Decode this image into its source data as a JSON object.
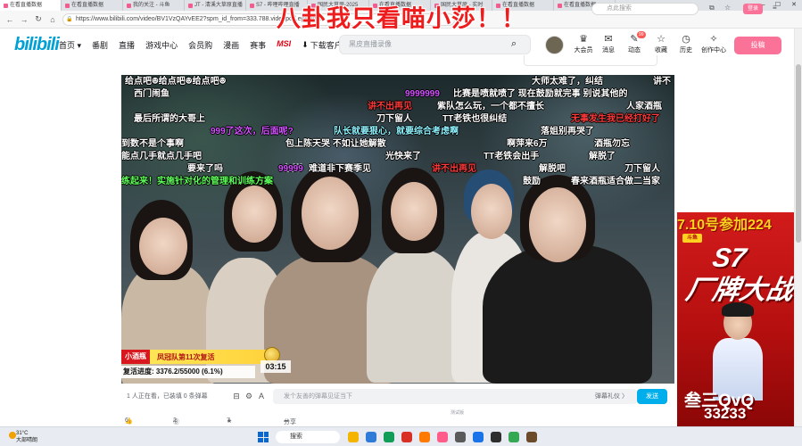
{
  "browser": {
    "tabs": [
      {
        "title": "在看直播数据"
      },
      {
        "title": "在看直播数据"
      },
      {
        "title": "我的关注 - 斗鱼"
      },
      {
        "title": "JT - 清溪大草原直播"
      },
      {
        "title": "S7 - 哔哩哔哩直播"
      },
      {
        "title": "国民大草原-2025"
      },
      {
        "title": "在看直播数据"
      },
      {
        "title": "国民大草原 - 实时"
      },
      {
        "title": "在看直播数据"
      },
      {
        "title": "在看直播数据"
      }
    ],
    "url": "https://www.bilibili.com/video/BV1VzQAYvEE2?spm_id_from=333.788.videopod.episodes",
    "search_placeholder": "点此搜索",
    "login_label": "登录"
  },
  "overlay_title": "八卦我只看喵小莎！！",
  "header": {
    "logo": "bilibili",
    "nav": [
      {
        "label": "首页 ▾"
      },
      {
        "label": "番剧"
      },
      {
        "label": "直播"
      },
      {
        "label": "游戏中心"
      },
      {
        "label": "会员购"
      },
      {
        "label": "漫画"
      },
      {
        "label": "赛事"
      },
      {
        "label": "MSI"
      },
      {
        "label": "下载客户端"
      }
    ],
    "search_placeholder": "黑皮直播录像",
    "right_items": [
      {
        "label": "大会员",
        "icon": "vip-icon"
      },
      {
        "label": "消息",
        "icon": "message-icon"
      },
      {
        "label": "动态",
        "icon": "dynamic-icon",
        "badge": "99"
      },
      {
        "label": "收藏",
        "icon": "star-icon"
      },
      {
        "label": "历史",
        "icon": "history-icon"
      },
      {
        "label": "创作中心",
        "icon": "creator-icon"
      }
    ],
    "upload_label": "投稿"
  },
  "video": {
    "streamer_logo": "bili",
    "danmaku": [
      {
        "text": "给点吧ꔮ给点吧ꔮ给点吧ꔮ",
        "color": "white"
      },
      {
        "text": "西门闹鱼",
        "color": "white"
      },
      {
        "text": "9999999",
        "color": "purple"
      },
      {
        "text": "比赛是喷就喷了 现在鼓励就完事 别说其他的",
        "color": "white"
      },
      {
        "text": "大师太难了，纠结",
        "color": "white"
      },
      {
        "text": "讲不",
        "color": "white"
      },
      {
        "text": "最后所谓的大哥上",
        "color": "white"
      },
      {
        "text": "讲不出再见",
        "color": "red"
      },
      {
        "text": "紫队怎么玩，一个都不擅长",
        "color": "white"
      },
      {
        "text": "人家酒瓶",
        "color": "white"
      },
      {
        "text": "刀下留人",
        "color": "white"
      },
      {
        "text": "TT老铁也很纠结",
        "color": "white"
      },
      {
        "text": "无事发生我已经打好了",
        "color": "red"
      },
      {
        "text": "999了这次，后面呢?",
        "color": "purple"
      },
      {
        "text": "队长就要狠心，就要综合考虑啊",
        "color": "cyan"
      },
      {
        "text": "落姐别再哭了",
        "color": "white"
      },
      {
        "text": "到数不是个事啊",
        "color": "white"
      },
      {
        "text": "包上陈天哭 不如让她解散",
        "color": "white"
      },
      {
        "text": "啊萍来6万",
        "color": "white"
      },
      {
        "text": "酒瓶勿忘",
        "color": "white"
      },
      {
        "text": "能点几手就点几手吧",
        "color": "white"
      },
      {
        "text": "光快来了",
        "color": "white"
      },
      {
        "text": "TT老铁会出手",
        "color": "white"
      },
      {
        "text": "解脱了",
        "color": "white"
      },
      {
        "text": "要来了吗",
        "color": "white"
      },
      {
        "text": "99999",
        "color": "purple"
      },
      {
        "text": "难道非下赛季见",
        "color": "white"
      },
      {
        "text": "讲不出再见",
        "color": "red"
      },
      {
        "text": "解脱吧",
        "color": "white"
      },
      {
        "text": "刀下留人",
        "color": "white"
      },
      {
        "text": "练起来！实施针对化的管理和训练方案",
        "color": "green"
      },
      {
        "text": "鼓励",
        "color": "white"
      },
      {
        "text": "春来酒瓶适合做二当家",
        "color": "white"
      }
    ],
    "overlay_tag": "小酒瓶",
    "overlay_text": "凤冠队第11次复活",
    "progress_label": "复活进度: 3376.2/55000 (6.1%)",
    "progress_fraction": 0.061,
    "timer": "03:15"
  },
  "below": {
    "viewers": "1 人正在看，已装填 0 条弹幕",
    "input_placeholder": "发个友善的弹幕见证当下",
    "etiquette": "弹幕礼仪 〉",
    "send_label": "发送",
    "test_label": "测试版",
    "actions": [
      {
        "icon": "like-icon",
        "count": "6"
      },
      {
        "icon": "coin-icon",
        "count": "2"
      },
      {
        "icon": "favorite-icon",
        "count": "7"
      },
      {
        "icon": "share-icon",
        "count": "分享"
      }
    ]
  },
  "ad": {
    "head": "7.10号参加224",
    "logo": "斗鱼",
    "title_1": "S7",
    "title_2": "厂牌大战",
    "name": "叁三QvQ",
    "number": "33233"
  },
  "taskbar": {
    "temperature": "31°C",
    "weather": "大部晴朗",
    "search_label": "搜索"
  }
}
